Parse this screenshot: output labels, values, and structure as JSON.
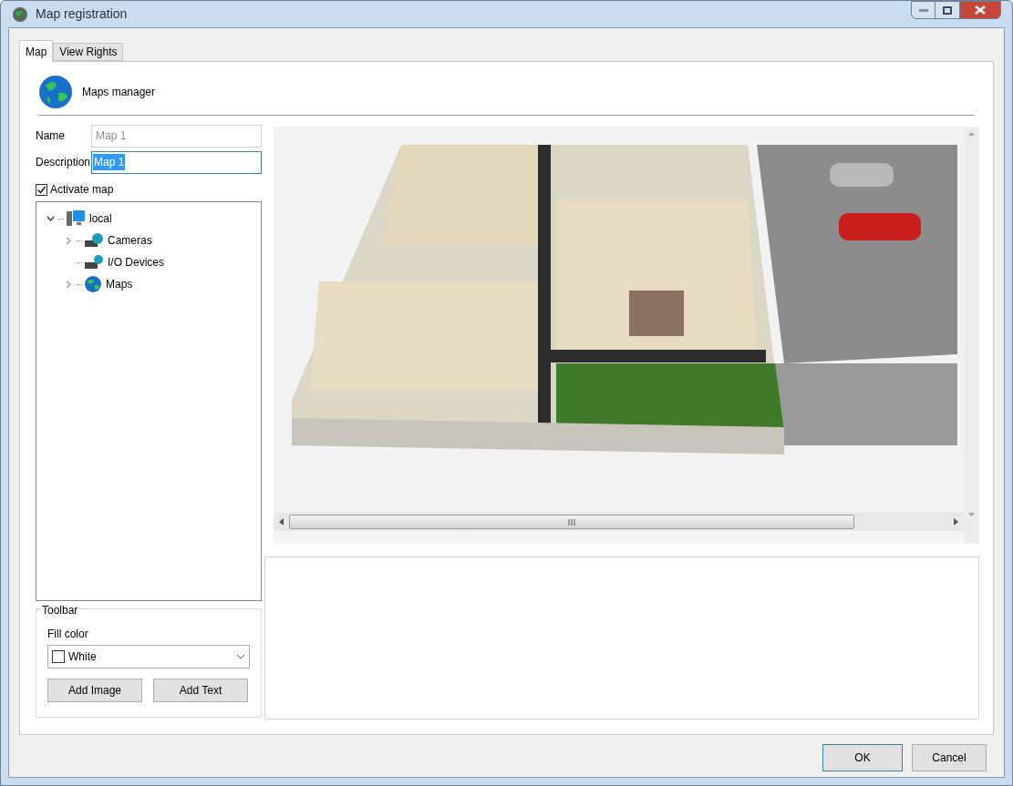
{
  "window": {
    "title": "Map registration"
  },
  "tabs": [
    {
      "label": "Map",
      "selected": true
    },
    {
      "label": "View Rights",
      "selected": false
    }
  ],
  "header": {
    "title": "Maps manager"
  },
  "form": {
    "name": {
      "label": "Name",
      "value": "Map 1",
      "disabled": true
    },
    "description": {
      "label": "Description",
      "value": "Map 1",
      "selected": true
    },
    "activate": {
      "label": "Activate map",
      "checked": true
    }
  },
  "tree": [
    {
      "label": "local",
      "expanded": true,
      "kind": "computer",
      "children": [
        {
          "label": "Cameras",
          "expanded": false,
          "kind": "camera"
        },
        {
          "label": "I/O Devices",
          "kind": "device"
        },
        {
          "label": "Maps",
          "expanded": false,
          "kind": "globe"
        }
      ]
    }
  ],
  "toolbar": {
    "title": "Toolbar",
    "fill_label": "Fill color",
    "fill_value": "White",
    "buttons": [
      "Add Image",
      "Add Text"
    ]
  },
  "footer_buttons": [
    "OK",
    "Cancel"
  ]
}
